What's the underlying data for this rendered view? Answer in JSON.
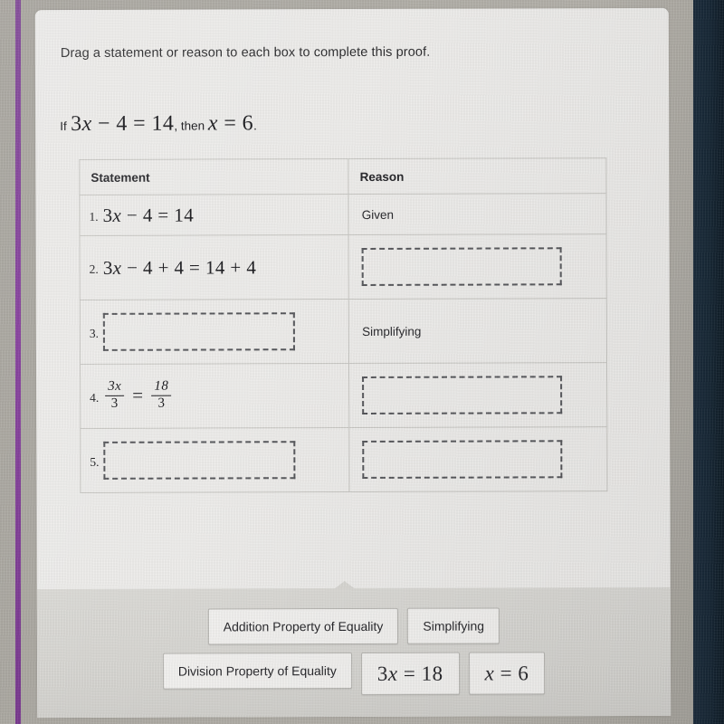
{
  "page": {
    "prompt": "Drag a statement or reason to each box to complete this proof.",
    "theorem": {
      "lead": "If",
      "hypothesis": "3x − 4 = 14",
      "connector": ", then ",
      "conclusion": "x = 6",
      "period": "."
    }
  },
  "table": {
    "headers": {
      "statement": "Statement",
      "reason": "Reason"
    },
    "rows": [
      {
        "number": "1.",
        "statement": "3x − 4 = 14",
        "statement_type": "math",
        "reason": "Given",
        "reason_type": "text"
      },
      {
        "number": "2.",
        "statement": "3x − 4 + 4 = 14 + 4",
        "statement_type": "math",
        "reason": "",
        "reason_type": "dropzone"
      },
      {
        "number": "3.",
        "statement": "",
        "statement_type": "dropzone",
        "reason": "Simplifying",
        "reason_type": "text"
      },
      {
        "number": "4.",
        "statement": "3x/3 = 18/3",
        "statement_type": "fraction",
        "fraction": {
          "left_numerator": "3x",
          "left_denominator": "3",
          "equals": "=",
          "right_numerator": "18",
          "right_denominator": "3"
        },
        "reason": "",
        "reason_type": "dropzone"
      },
      {
        "number": "5.",
        "statement": "",
        "statement_type": "dropzone",
        "reason": "",
        "reason_type": "dropzone"
      }
    ]
  },
  "tray": {
    "rows": [
      [
        {
          "label": "Addition Property of Equality",
          "kind": "text"
        },
        {
          "label": "Simplifying",
          "kind": "text"
        }
      ],
      [
        {
          "label": "Division Property of Equality",
          "kind": "text"
        },
        {
          "label": "3x = 18",
          "kind": "math"
        },
        {
          "label": "x = 6",
          "kind": "math"
        }
      ]
    ]
  },
  "colors": {
    "accent_rail": "#7a3f92",
    "dark_band": "#16273f",
    "card_background": "#eeedeb",
    "page_background": "#a9a69f",
    "tray_background": "#d8d7d3",
    "dropzone_border": "#55565a",
    "table_border": "#c9c8c4"
  }
}
